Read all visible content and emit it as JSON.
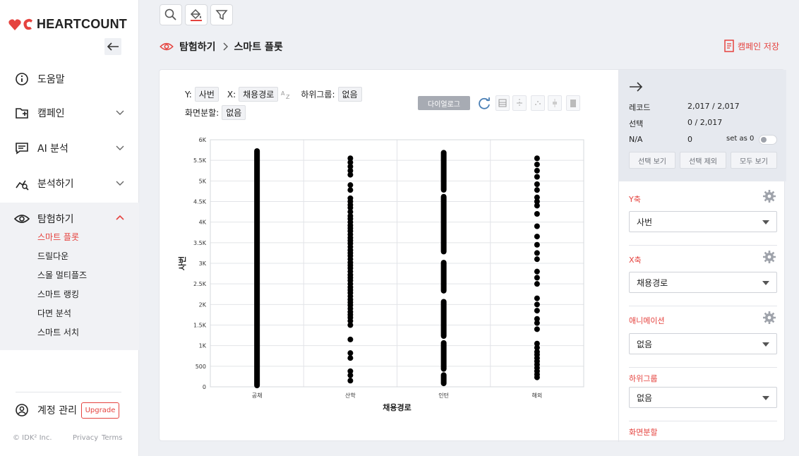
{
  "app": {
    "brand": "HEARTCOUNT",
    "brand_color": "#e5433f"
  },
  "sidebar": {
    "items": [
      {
        "label": "도움말",
        "icon": "info-icon"
      },
      {
        "label": "캠페인",
        "icon": "campaign-add-icon"
      },
      {
        "label": "AI 분석",
        "icon": "chat-icon"
      },
      {
        "label": "분석하기",
        "icon": "analysis-chart-icon"
      },
      {
        "label": "탐험하기",
        "icon": "eye-icon"
      }
    ],
    "sub_items": [
      "스마트 플롯",
      "드릴다운",
      "스몰 멀티플즈",
      "스마트 랭킹",
      "다면 분석",
      "스마트 서치"
    ],
    "account_label": "계정 관리",
    "upgrade_label": "Upgrade",
    "copyright": "© IDK² Inc.",
    "privacy": "Privacy",
    "terms": "Terms"
  },
  "breadcrumb": {
    "root": "탐험하기",
    "current": "스마트 플롯"
  },
  "save_campaign": "캠페인 저장",
  "controls": {
    "y_label": "Y:",
    "y_value": "사번",
    "x_label": "X:",
    "x_value": "채용경로",
    "sub_label": "하위그룹:",
    "sub_value": "없음",
    "split_label": "화면분할:",
    "split_value": "없음",
    "dialog": "다이얼로그"
  },
  "stats": {
    "record_label": "레코드",
    "record_value": "2,017 / 2,017",
    "select_label": "선택",
    "select_value": "0 / 2,017",
    "na_label": "N/A",
    "na_value": "0",
    "setas_label": "set as 0",
    "btn_view": "선택 보기",
    "btn_exclude": "선택 제외",
    "btn_all": "모두 보기"
  },
  "panel": {
    "y_title": "Y축",
    "y_value": "사번",
    "x_title": "X축",
    "x_value": "채용경로",
    "anim_title": "애니메이션",
    "anim_value": "없음",
    "sub_title": "하위그룹",
    "sub_value": "없음",
    "split_title": "화면분할"
  },
  "chart_data": {
    "type": "scatter",
    "categories": [
      "공채",
      "산학",
      "인턴",
      "해외"
    ],
    "xlabel": "채용경로",
    "ylabel": "사번",
    "ylim": [
      0,
      6000
    ],
    "yticks": [
      0,
      500,
      1000,
      1500,
      2000,
      2500,
      3000,
      3500,
      4000,
      4500,
      5000,
      5500,
      6000
    ],
    "ytick_labels": [
      "0",
      "500",
      "1K",
      "1.5K",
      "2K",
      "2.5K",
      "3K",
      "3.5K",
      "4K",
      "4.5K",
      "5K",
      "5.5K",
      "6K"
    ],
    "grid": true,
    "series": [
      {
        "category": "공채",
        "continuous_range": [
          0,
          5760
        ]
      },
      {
        "category": "산학",
        "values": [
          5550,
          5450,
          5350,
          5250,
          5150,
          4900,
          4780,
          4580,
          4500,
          4420,
          4350,
          4250,
          4150,
          4080,
          4000,
          3920,
          3850,
          3780,
          3700,
          3620,
          3550,
          3480,
          3400,
          3320,
          3250,
          3180,
          3100,
          3020,
          2950,
          2880,
          2800,
          2720,
          2650,
          2580,
          2500,
          2420,
          2350,
          2280,
          2200,
          2120,
          2050,
          1980,
          1900,
          1820,
          1750,
          1680,
          1600,
          1500,
          1150,
          820,
          700,
          380,
          280,
          150
        ]
      },
      {
        "category": "인턴",
        "continuous_segments": [
          [
            4750,
            5720
          ],
          [
            3250,
            4650
          ],
          [
            2300,
            3050
          ],
          [
            1200,
            2100
          ],
          [
            400,
            1100
          ],
          [
            50,
            320
          ]
        ]
      },
      {
        "category": "해외",
        "values": [
          5550,
          5400,
          5250,
          5100,
          4920,
          4780,
          4600,
          4500,
          4400,
          4200,
          3900,
          3650,
          3450,
          3250,
          3100,
          2800,
          2650,
          2500,
          2150,
          2000,
          1850,
          1650,
          1550,
          1400,
          1050,
          950,
          850,
          780,
          700,
          620,
          540,
          460,
          380,
          300,
          230
        ]
      }
    ]
  }
}
